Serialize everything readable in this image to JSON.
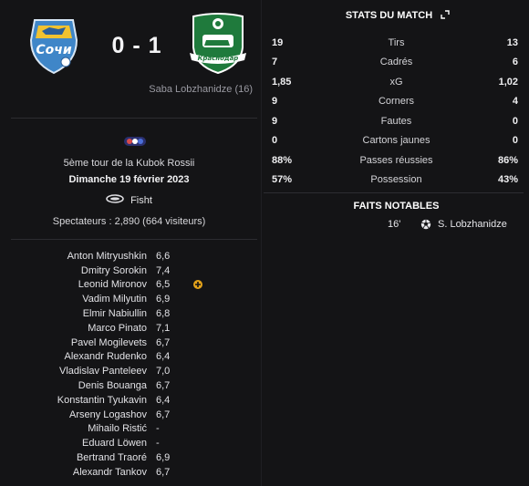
{
  "match": {
    "home_team_crest_text": "Сочи",
    "away_team_crest_text": "Краснодар",
    "score": "0 - 1",
    "scorer": "Saba Lobzhanidze (16)"
  },
  "info": {
    "round": "5ème tour de la Kubok Rossii",
    "date": "Dimanche 19 février 2023",
    "stadium": "Fisht",
    "attendance": "Spectateurs : 2,890 (664 visiteurs)"
  },
  "players": [
    {
      "name": "Anton Mitryushkin",
      "rating": "6,6"
    },
    {
      "name": "Dmitry Sorokin",
      "rating": "7,4"
    },
    {
      "name": "Leonid Mironov",
      "rating": "6,5",
      "event": "substitution-icon"
    },
    {
      "name": "Vadim Milyutin",
      "rating": "6,9"
    },
    {
      "name": "Elmir Nabiullin",
      "rating": "6,8"
    },
    {
      "name": "Marco Pinato",
      "rating": "7,1"
    },
    {
      "name": "Pavel Mogilevets",
      "rating": "6,7"
    },
    {
      "name": "Alexandr Rudenko",
      "rating": "6,4"
    },
    {
      "name": "Vladislav Panteleev",
      "rating": "7,0"
    },
    {
      "name": "Denis Bouanga",
      "rating": "6,7"
    },
    {
      "name": "Konstantin Tyukavin",
      "rating": "6,4"
    },
    {
      "name": "Arseny Logashov",
      "rating": "6,7"
    },
    {
      "name": "Mihailo Ristić",
      "rating": "-"
    },
    {
      "name": "Eduard Löwen",
      "rating": "-"
    },
    {
      "name": "Bertrand Traoré",
      "rating": "6,9"
    },
    {
      "name": "Alexandr Tankov",
      "rating": "6,7"
    }
  ],
  "stats": {
    "title": "STATS DU MATCH",
    "rows": [
      {
        "home": "19",
        "label": "Tirs",
        "away": "13"
      },
      {
        "home": "7",
        "label": "Cadrés",
        "away": "6"
      },
      {
        "home": "1,85",
        "label": "xG",
        "away": "1,02"
      },
      {
        "home": "9",
        "label": "Corners",
        "away": "4"
      },
      {
        "home": "9",
        "label": "Fautes",
        "away": "0"
      },
      {
        "home": "0",
        "label": "Cartons jaunes",
        "away": "0"
      },
      {
        "home": "88%",
        "label": "Passes réussies",
        "away": "86%"
      },
      {
        "home": "57%",
        "label": "Possession",
        "away": "43%"
      }
    ]
  },
  "notable": {
    "title": "FAITS NOTABLES",
    "events": [
      {
        "minute": "16'",
        "icon": "goal-ball-icon",
        "player": "S. Lobzhanidze"
      }
    ]
  },
  "colors": {
    "background": "#141416",
    "home_crest": "#3f86c8",
    "away_crest": "#1f7a3c",
    "substitution": "#e3a21a"
  }
}
